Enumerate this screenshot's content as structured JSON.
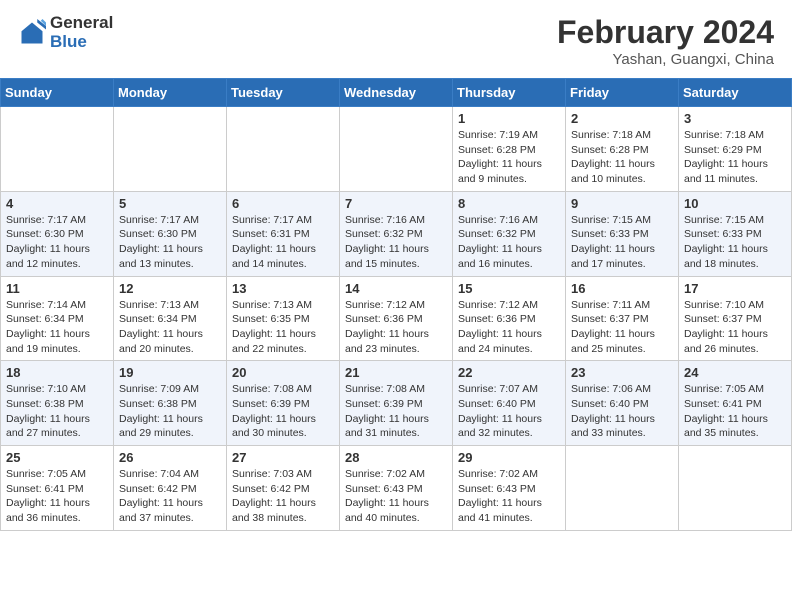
{
  "header": {
    "logo_general": "General",
    "logo_blue": "Blue",
    "month_year": "February 2024",
    "location": "Yashan, Guangxi, China"
  },
  "days_of_week": [
    "Sunday",
    "Monday",
    "Tuesday",
    "Wednesday",
    "Thursday",
    "Friday",
    "Saturday"
  ],
  "weeks": [
    [
      {
        "day": "",
        "info": ""
      },
      {
        "day": "",
        "info": ""
      },
      {
        "day": "",
        "info": ""
      },
      {
        "day": "",
        "info": ""
      },
      {
        "day": "1",
        "info": "Sunrise: 7:19 AM\nSunset: 6:28 PM\nDaylight: 11 hours and 9 minutes."
      },
      {
        "day": "2",
        "info": "Sunrise: 7:18 AM\nSunset: 6:28 PM\nDaylight: 11 hours and 10 minutes."
      },
      {
        "day": "3",
        "info": "Sunrise: 7:18 AM\nSunset: 6:29 PM\nDaylight: 11 hours and 11 minutes."
      }
    ],
    [
      {
        "day": "4",
        "info": "Sunrise: 7:17 AM\nSunset: 6:30 PM\nDaylight: 11 hours and 12 minutes."
      },
      {
        "day": "5",
        "info": "Sunrise: 7:17 AM\nSunset: 6:30 PM\nDaylight: 11 hours and 13 minutes."
      },
      {
        "day": "6",
        "info": "Sunrise: 7:17 AM\nSunset: 6:31 PM\nDaylight: 11 hours and 14 minutes."
      },
      {
        "day": "7",
        "info": "Sunrise: 7:16 AM\nSunset: 6:32 PM\nDaylight: 11 hours and 15 minutes."
      },
      {
        "day": "8",
        "info": "Sunrise: 7:16 AM\nSunset: 6:32 PM\nDaylight: 11 hours and 16 minutes."
      },
      {
        "day": "9",
        "info": "Sunrise: 7:15 AM\nSunset: 6:33 PM\nDaylight: 11 hours and 17 minutes."
      },
      {
        "day": "10",
        "info": "Sunrise: 7:15 AM\nSunset: 6:33 PM\nDaylight: 11 hours and 18 minutes."
      }
    ],
    [
      {
        "day": "11",
        "info": "Sunrise: 7:14 AM\nSunset: 6:34 PM\nDaylight: 11 hours and 19 minutes."
      },
      {
        "day": "12",
        "info": "Sunrise: 7:13 AM\nSunset: 6:34 PM\nDaylight: 11 hours and 20 minutes."
      },
      {
        "day": "13",
        "info": "Sunrise: 7:13 AM\nSunset: 6:35 PM\nDaylight: 11 hours and 22 minutes."
      },
      {
        "day": "14",
        "info": "Sunrise: 7:12 AM\nSunset: 6:36 PM\nDaylight: 11 hours and 23 minutes."
      },
      {
        "day": "15",
        "info": "Sunrise: 7:12 AM\nSunset: 6:36 PM\nDaylight: 11 hours and 24 minutes."
      },
      {
        "day": "16",
        "info": "Sunrise: 7:11 AM\nSunset: 6:37 PM\nDaylight: 11 hours and 25 minutes."
      },
      {
        "day": "17",
        "info": "Sunrise: 7:10 AM\nSunset: 6:37 PM\nDaylight: 11 hours and 26 minutes."
      }
    ],
    [
      {
        "day": "18",
        "info": "Sunrise: 7:10 AM\nSunset: 6:38 PM\nDaylight: 11 hours and 27 minutes."
      },
      {
        "day": "19",
        "info": "Sunrise: 7:09 AM\nSunset: 6:38 PM\nDaylight: 11 hours and 29 minutes."
      },
      {
        "day": "20",
        "info": "Sunrise: 7:08 AM\nSunset: 6:39 PM\nDaylight: 11 hours and 30 minutes."
      },
      {
        "day": "21",
        "info": "Sunrise: 7:08 AM\nSunset: 6:39 PM\nDaylight: 11 hours and 31 minutes."
      },
      {
        "day": "22",
        "info": "Sunrise: 7:07 AM\nSunset: 6:40 PM\nDaylight: 11 hours and 32 minutes."
      },
      {
        "day": "23",
        "info": "Sunrise: 7:06 AM\nSunset: 6:40 PM\nDaylight: 11 hours and 33 minutes."
      },
      {
        "day": "24",
        "info": "Sunrise: 7:05 AM\nSunset: 6:41 PM\nDaylight: 11 hours and 35 minutes."
      }
    ],
    [
      {
        "day": "25",
        "info": "Sunrise: 7:05 AM\nSunset: 6:41 PM\nDaylight: 11 hours and 36 minutes."
      },
      {
        "day": "26",
        "info": "Sunrise: 7:04 AM\nSunset: 6:42 PM\nDaylight: 11 hours and 37 minutes."
      },
      {
        "day": "27",
        "info": "Sunrise: 7:03 AM\nSunset: 6:42 PM\nDaylight: 11 hours and 38 minutes."
      },
      {
        "day": "28",
        "info": "Sunrise: 7:02 AM\nSunset: 6:43 PM\nDaylight: 11 hours and 40 minutes."
      },
      {
        "day": "29",
        "info": "Sunrise: 7:02 AM\nSunset: 6:43 PM\nDaylight: 11 hours and 41 minutes."
      },
      {
        "day": "",
        "info": ""
      },
      {
        "day": "",
        "info": ""
      }
    ]
  ]
}
